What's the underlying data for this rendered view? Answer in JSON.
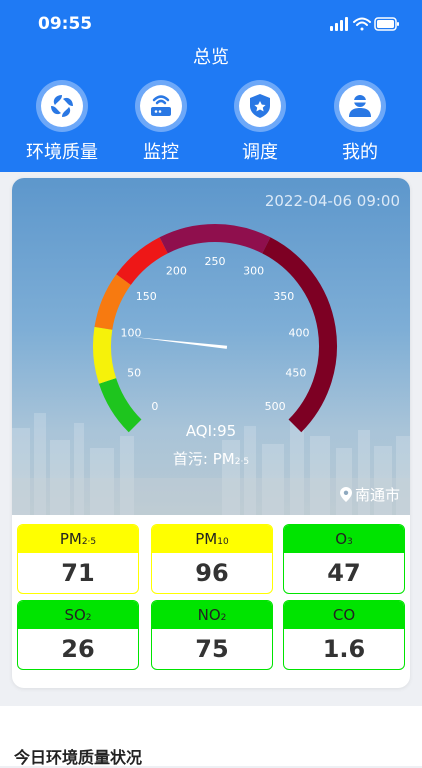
{
  "status": {
    "time": "09:55"
  },
  "header": {
    "title": "总览"
  },
  "nav": [
    {
      "label": "环境质量",
      "icon": "leaf-icon"
    },
    {
      "label": "监控",
      "icon": "router-icon"
    },
    {
      "label": "调度",
      "icon": "badge-icon"
    },
    {
      "label": "我的",
      "icon": "user-icon"
    }
  ],
  "gauge": {
    "timestamp": "2022-04-06 09:00",
    "aqi_label": "AQI:95",
    "aqi_value": 95,
    "primary_label": "首污: PM",
    "primary_sub": "2·5",
    "location": "南通市",
    "ticks": [
      "0",
      "50",
      "100",
      "150",
      "200",
      "250",
      "300",
      "350",
      "400",
      "450",
      "500"
    ],
    "band_colors": [
      "#1ec51e",
      "#f6f20a",
      "#f77a10",
      "#ee1717",
      "#8f0f4d",
      "#7d0023"
    ]
  },
  "pollutants": [
    {
      "name": "PM",
      "sub": "2·5",
      "value": "71",
      "color": "#ffff00"
    },
    {
      "name": "PM",
      "sub": "10",
      "value": "96",
      "color": "#ffff00"
    },
    {
      "name": "O",
      "sub": "3",
      "value": "47",
      "color": "#00e400"
    },
    {
      "name": "SO",
      "sub": "2",
      "value": "26",
      "color": "#00e400"
    },
    {
      "name": "NO",
      "sub": "2",
      "value": "75",
      "color": "#00e400"
    },
    {
      "name": "CO",
      "sub": "",
      "value": "1.6",
      "color": "#00e400"
    }
  ],
  "bottom": {
    "title": "今日环境质量状况"
  }
}
